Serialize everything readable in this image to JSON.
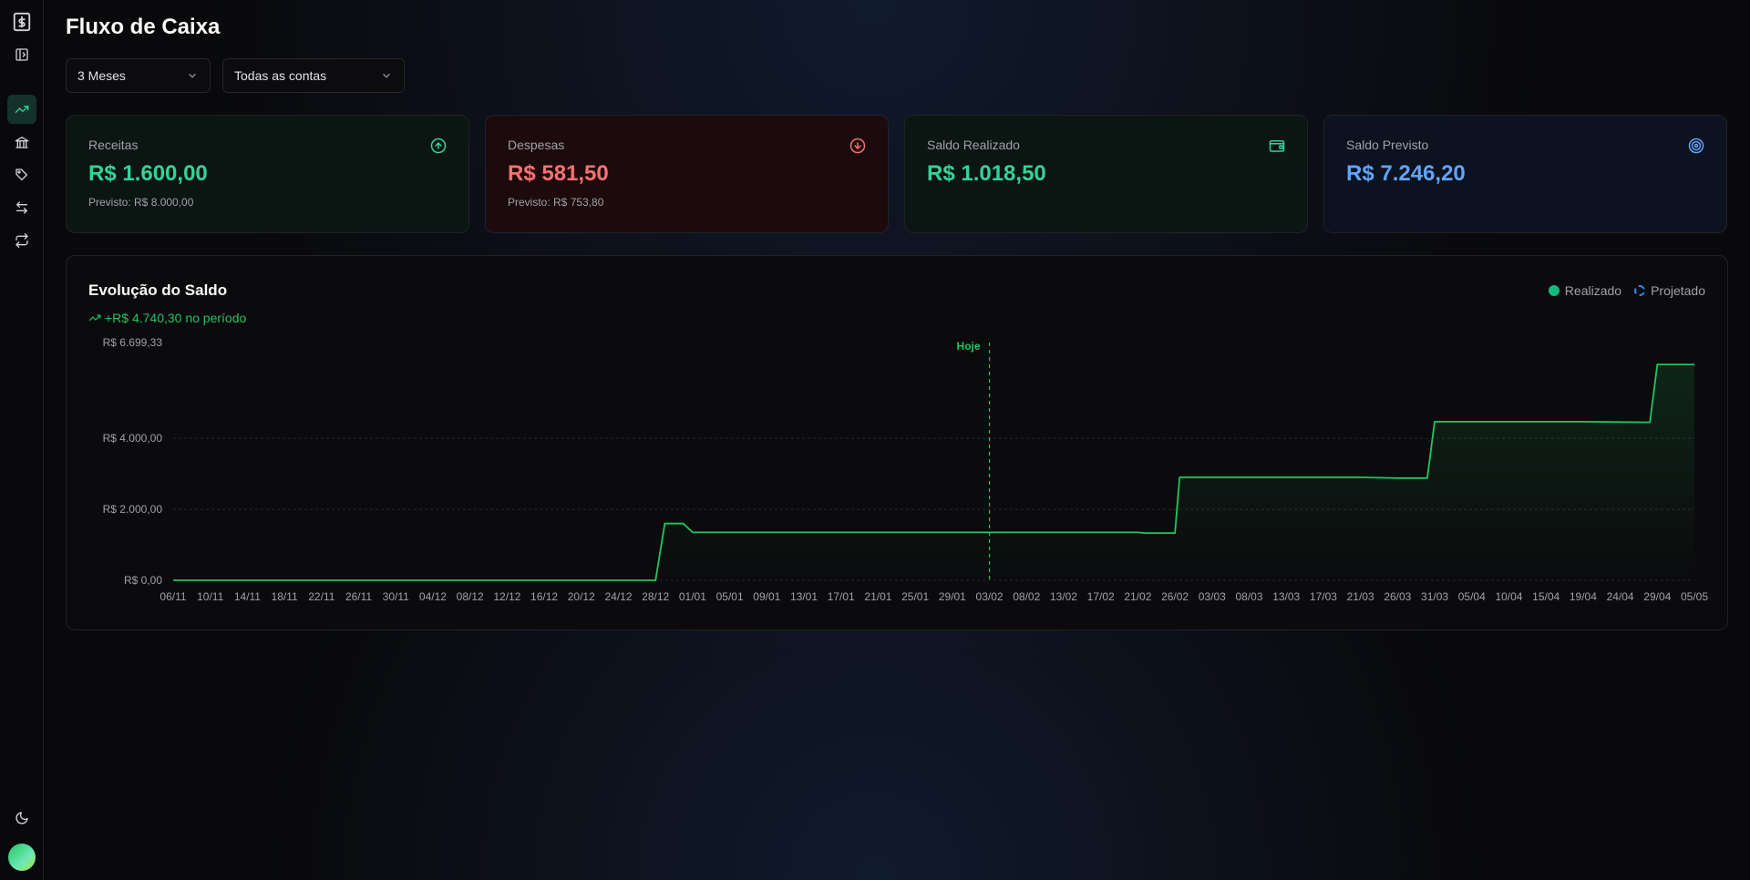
{
  "page": {
    "title": "Fluxo de Caixa"
  },
  "sidebar": {
    "icons": [
      "dollar-logo-icon",
      "panel-toggle-icon",
      "trending-up-icon",
      "bank-icon",
      "tag-icon",
      "transfer-icon",
      "repeat-icon"
    ],
    "bottom": [
      "moon-icon",
      "avatar"
    ]
  },
  "filters": {
    "period": {
      "value": "3 Meses"
    },
    "account": {
      "value": "Todas as contas"
    }
  },
  "cards": [
    {
      "label": "Receitas",
      "value": "R$ 1.600,00",
      "sub": "Previsto: R$ 8.000,00",
      "color": "#34d399",
      "icon": "arrow-up-circle-icon"
    },
    {
      "label": "Despesas",
      "value": "R$ 581,50",
      "sub": "Previsto: R$ 753,80",
      "color": "#f87171",
      "icon": "arrow-down-circle-icon"
    },
    {
      "label": "Saldo Realizado",
      "value": "R$ 1.018,50",
      "sub": "",
      "color": "#34d399",
      "icon": "wallet-icon"
    },
    {
      "label": "Saldo Previsto",
      "value": "R$ 7.246,20",
      "sub": "",
      "color": "#60a5fa",
      "icon": "target-icon"
    }
  ],
  "chart": {
    "title": "Evolução do Saldo",
    "subtitle": "+R$ 4.740,30 no período",
    "legend_realized": "Realizado",
    "legend_projected": "Projetado",
    "today_label": "Hoje"
  },
  "chart_data": {
    "type": "line",
    "title": "Evolução do Saldo",
    "x_ticks": [
      "06/11",
      "10/11",
      "14/11",
      "18/11",
      "22/11",
      "26/11",
      "30/11",
      "04/12",
      "08/12",
      "12/12",
      "16/12",
      "20/12",
      "24/12",
      "28/12",
      "01/01",
      "05/01",
      "09/01",
      "13/01",
      "17/01",
      "21/01",
      "25/01",
      "29/01",
      "03/02",
      "08/02",
      "13/02",
      "17/02",
      "21/02",
      "26/02",
      "03/03",
      "08/03",
      "13/03",
      "17/03",
      "21/03",
      "26/03",
      "31/03",
      "05/04",
      "10/04",
      "15/04",
      "19/04",
      "24/04",
      "29/04",
      "05/05"
    ],
    "y_ticks": [
      "R$ 0,00",
      "R$ 2.000,00",
      "R$ 4.000,00",
      "R$ 6.699,33"
    ],
    "y_tick_values": [
      0,
      2000,
      4000,
      6699.33
    ],
    "ylim": [
      0,
      6699.33
    ],
    "today": "03/02",
    "series": [
      {
        "name": "Realizado",
        "color": "#22c55e",
        "points": [
          [
            "06/11",
            0
          ],
          [
            "28/12",
            0
          ],
          [
            "29/12",
            1600
          ],
          [
            "31/12",
            1600
          ],
          [
            "01/01",
            1350
          ],
          [
            "21/02",
            1350
          ],
          [
            "22/02",
            1330
          ],
          [
            "26/02",
            1330
          ],
          [
            "27/02",
            2900
          ],
          [
            "21/03",
            2900
          ],
          [
            "26/03",
            2880
          ],
          [
            "30/03",
            2880
          ],
          [
            "31/03",
            4470
          ],
          [
            "19/04",
            4470
          ],
          [
            "28/04",
            4450
          ],
          [
            "29/04",
            6080
          ],
          [
            "05/05",
            6080
          ]
        ]
      }
    ]
  }
}
